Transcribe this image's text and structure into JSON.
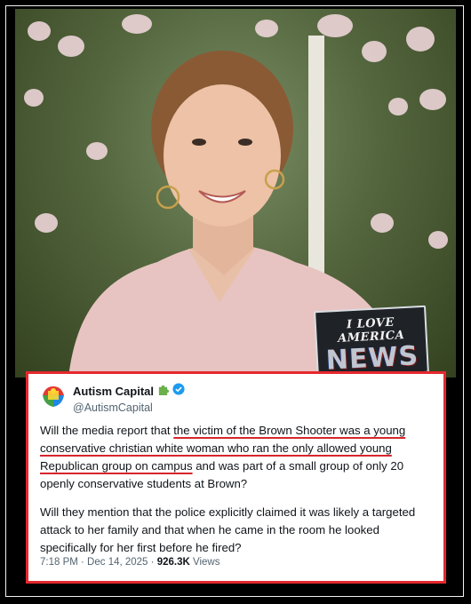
{
  "stamp": {
    "line1": "I LOVE AMERICA",
    "line2": "NEWS"
  },
  "tweet": {
    "author_name": "Autism Capital",
    "handle": "@AutismCapital",
    "icons": [
      "puzzle-avatar-icon",
      "puzzle-piece-emoji-icon",
      "verified-badge-icon"
    ],
    "p1": {
      "a": "Will the media report that ",
      "u1": "the victim of the Brown Shooter was a young conservative christian white woman who ran the only allowed young Republican group on campus",
      "b": " and was part of a small group of only 20 openly conservative students at Brown?"
    },
    "p2": "Will they mention that the police explicitly claimed it was likely a targeted attack to her family and that when he came in the room he looked specifically for her first before he fired?",
    "timestamp": "7:18 PM · Dec 14, 2025 · ",
    "views_count": "926.3K",
    "views_label": " Views"
  },
  "colors": {
    "highlight_border": "#e5282e",
    "underline": "#d7262b",
    "verified": "#1d9bf0"
  }
}
